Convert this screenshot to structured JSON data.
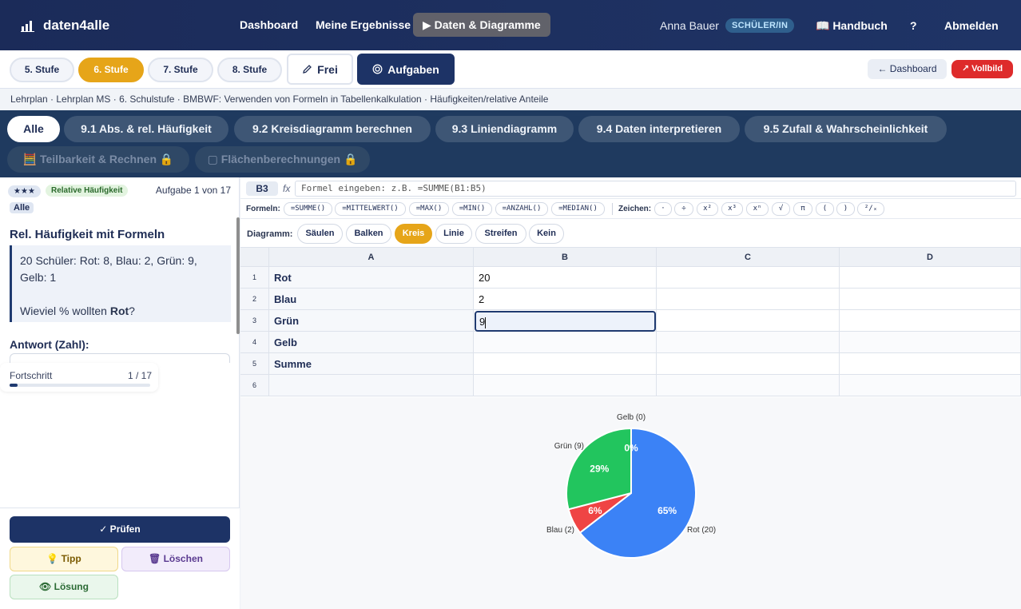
{
  "nav": {
    "logo": "daten4alle",
    "links": [
      "Dashboard",
      "Meine Ergebnisse",
      "▶ Daten & Diagramme"
    ],
    "user": "Anna Bauer",
    "role": "SCHÜLER/IN",
    "handbuch": "📖 Handbuch",
    "help": "?",
    "logout": "Abmelden"
  },
  "levels": [
    "5. Stufe",
    "6. Stufe",
    "7. Stufe",
    "8. Stufe"
  ],
  "mode": {
    "frei": "Frei",
    "aufgaben": "Aufgaben"
  },
  "right_buttons": {
    "dashboard": "← Dashboard",
    "vollbild": "↗ Vollbild"
  },
  "breadcrumb": "Lehrplan · Lehrplan MS · 6. Schulstufe · BMBWF: Verwenden von Formeln in Tabellenkalkulation · Häufigkeiten/relative Anteile",
  "topics": {
    "row1": [
      "Alle",
      "9.1 Abs. & rel. Häufigkeit",
      "9.2 Kreisdiagramm berechnen",
      "9.3 Liniendiagramm",
      "9.4 Daten interpretieren",
      "9.5 Zufall & Wahrscheinlichkeit"
    ],
    "row2": [
      "🧮 Teilbarkeit & Rechnen 🔒",
      "▢ Flächenberechnungen 🔒"
    ]
  },
  "task": {
    "stars": "★★★",
    "tag": "Relative Häufigkeit",
    "counter": "Aufgabe 1 von 17",
    "filter": "Alle",
    "title": "Rel. Häufigkeit mit Formeln",
    "text1": "20 Schüler: Rot: 8, Blau: 2, Grün: 9, Gelb: 1",
    "question_pre": "Wieviel % wollten ",
    "question_bold": "Rot",
    "question_post": "?",
    "answer_label": "Antwort (Zahl):"
  },
  "progress": {
    "label": "Fortschritt",
    "value": "1 / 17",
    "fraction": 0.0588
  },
  "actions": {
    "pruefen": "✓ Prüfen",
    "tipp": "💡 Tipp",
    "loeschen": "🗑 Löschen",
    "loesung": "👁 Lösung"
  },
  "formula": {
    "cell": "B3",
    "fx": "fx",
    "placeholder": "Formel eingeben: z.B. =SUMME(B1:B5)"
  },
  "functions": {
    "label": "Formeln:",
    "items": [
      "=SUMME()",
      "=MITTELWERT()",
      "=MAX()",
      "=MIN()",
      "=ANZAHL()",
      "=MEDIAN()"
    ],
    "symbols_label": "Zeichen:",
    "symbols": [
      "·",
      "÷",
      "x²",
      "x³",
      "xⁿ",
      "√",
      "π",
      "(",
      ")",
      "²/ₓ"
    ]
  },
  "chart_types": {
    "label": "Diagramm:",
    "items": [
      "Säulen",
      "Balken",
      "Kreis",
      "Linie",
      "Streifen",
      "Kein"
    ],
    "active": "Kreis"
  },
  "sheet": {
    "columns": [
      "A",
      "B",
      "C",
      "D"
    ],
    "rows": [
      {
        "n": "1",
        "a": "Rot",
        "b": "20"
      },
      {
        "n": "2",
        "a": "Blau",
        "b": "2"
      },
      {
        "n": "3",
        "a": "Grün",
        "b": "9"
      },
      {
        "n": "4",
        "a": "Gelb",
        "b": ""
      },
      {
        "n": "5",
        "a": "Summe",
        "b": ""
      },
      {
        "n": "6",
        "a": "",
        "b": ""
      }
    ]
  },
  "chart_data": {
    "type": "pie",
    "slices": [
      {
        "label": "Rot (20)",
        "value": 20,
        "pct": "65%",
        "color": "#3b82f6"
      },
      {
        "label": "Blau (2)",
        "value": 2,
        "pct": "6%",
        "color": "#ef4444"
      },
      {
        "label": "Grün (9)",
        "value": 9,
        "pct": "29%",
        "color": "#22c55e"
      },
      {
        "label": "Gelb (0)",
        "value": 0,
        "pct": "0%",
        "color": "#eab308"
      }
    ]
  }
}
